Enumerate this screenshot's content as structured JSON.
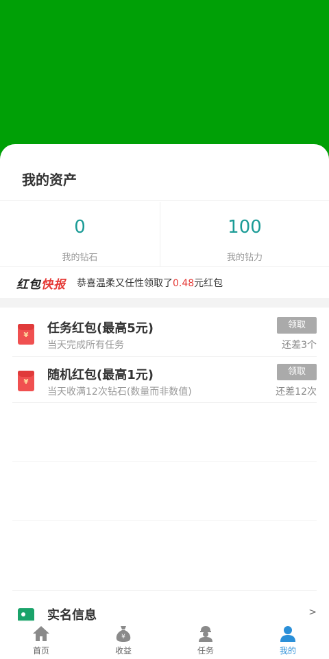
{
  "assets": {
    "title": "我的资产",
    "diamond_value": "0",
    "diamond_label": "我的钻石",
    "power_value": "100",
    "power_label": "我的钻力"
  },
  "news": {
    "logo_part1": "红包",
    "logo_part2": "快报",
    "text_before": "恭喜温柔又任性领取了",
    "amount": "0.48",
    "text_after": "元红包"
  },
  "tasks": [
    {
      "title": "任务红包(最高5元)",
      "subtitle": "当天完成所有任务",
      "button": "领取",
      "remaining": "还差3个",
      "icon": "red-envelope-icon"
    },
    {
      "title": "随机红包(最高1元)",
      "subtitle": "当天收满12次钻石(数量而非数值)",
      "button": "领取",
      "remaining": "还差12次",
      "icon": "red-envelope-icon"
    }
  ],
  "profile": {
    "real_name_label": "实名信息",
    "arrow": ">"
  },
  "tabbar": {
    "items": [
      {
        "label": "首页",
        "icon": "home-icon"
      },
      {
        "label": "收益",
        "icon": "money-bag-icon"
      },
      {
        "label": "任务",
        "icon": "worker-icon"
      },
      {
        "label": "我的",
        "icon": "user-icon",
        "active": true
      }
    ]
  },
  "colors": {
    "header": "#00a006",
    "accent": "#1a9b96",
    "red": "#e53935",
    "active_tab": "#2a8fd8"
  }
}
